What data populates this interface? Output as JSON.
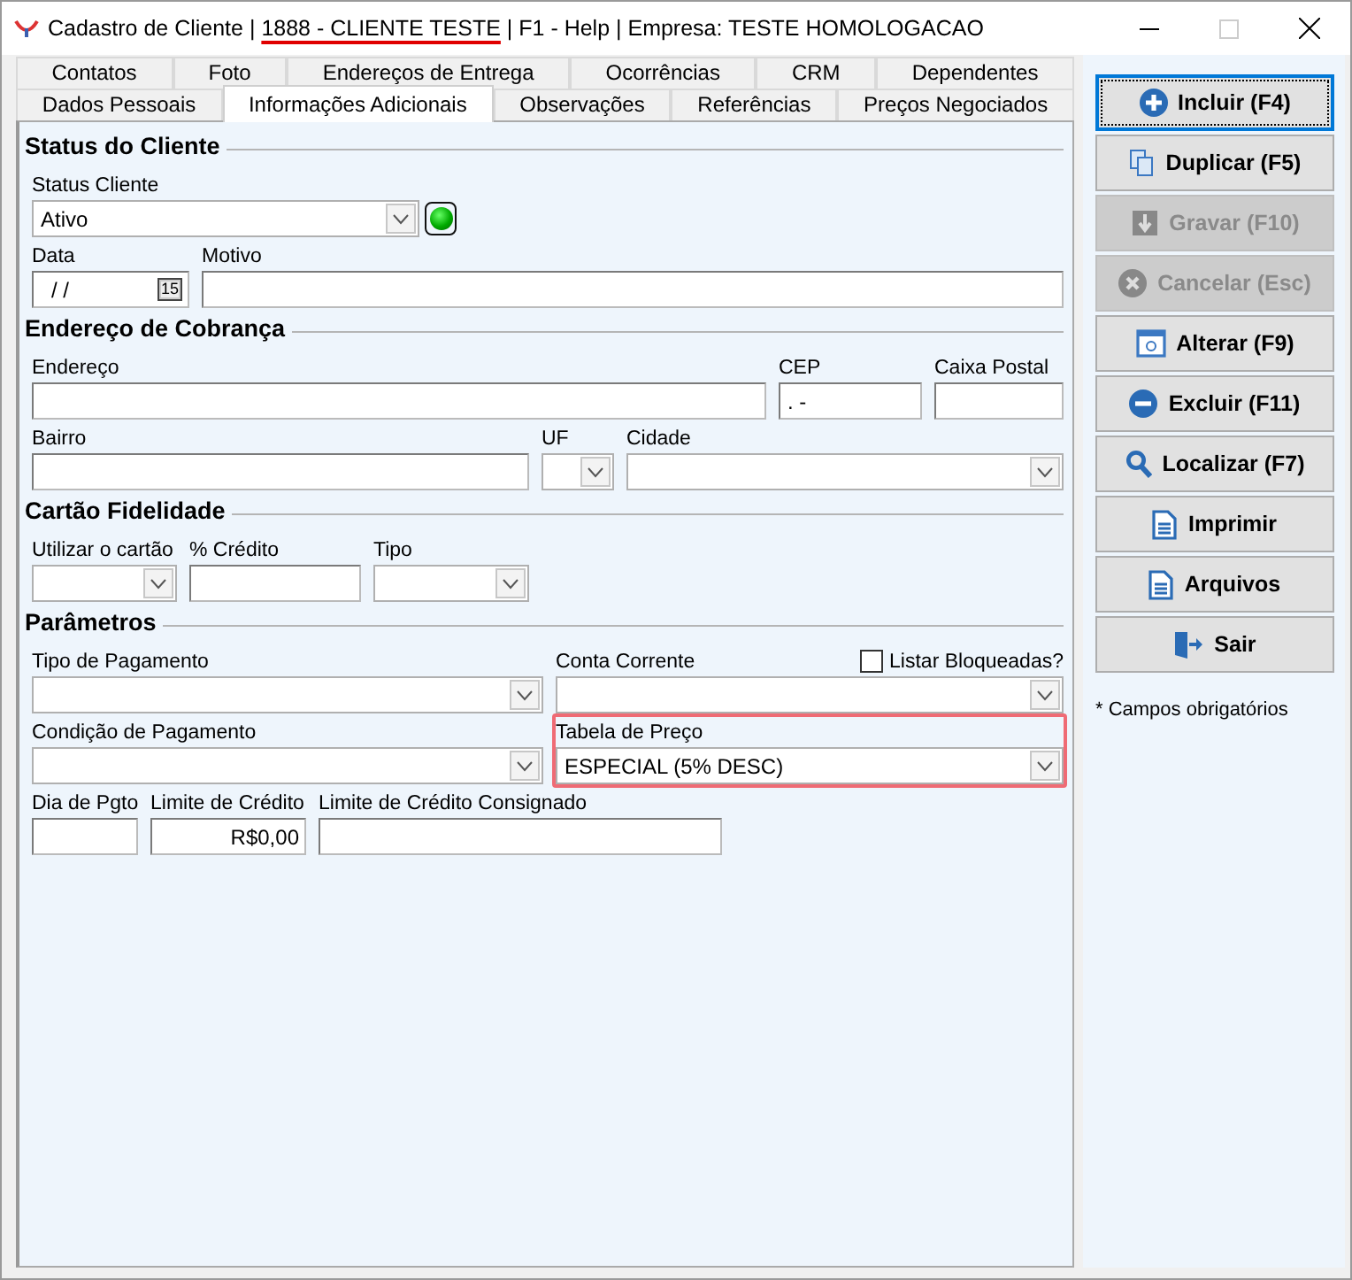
{
  "window": {
    "title_prefix": "Cadastro de Cliente |",
    "title_record": "1888 - CLIENTE TESTE",
    "title_suffix": "| F1 - Help | Empresa: TESTE HOMOLOGACAO",
    "maximize_disabled": true
  },
  "tab_rows": [
    [
      {
        "label": "Contatos",
        "selected": false
      },
      {
        "label": "Foto",
        "selected": false
      },
      {
        "label": "Endereços de Entrega",
        "selected": false
      },
      {
        "label": "Ocorrências",
        "selected": false
      },
      {
        "label": "CRM",
        "selected": false
      },
      {
        "label": "Dependentes",
        "selected": false
      }
    ],
    [
      {
        "label": "Dados Pessoais",
        "selected": false
      },
      {
        "label": "Informações Adicionais",
        "selected": true
      },
      {
        "label": "Observações",
        "selected": false
      },
      {
        "label": "Referências",
        "selected": false
      },
      {
        "label": "Preços Negociados",
        "selected": false
      }
    ]
  ],
  "sections": [
    {
      "title": "Status do Cliente",
      "rows": [
        [
          {
            "label": "Status Cliente",
            "kind": "select",
            "value": "Ativo",
            "indicator_on": true
          }
        ],
        [
          {
            "label": "Data",
            "kind": "date",
            "value": "/ /",
            "calendar_day": "15"
          },
          {
            "label": "Motivo",
            "kind": "input"
          }
        ]
      ]
    },
    {
      "title": "Endereço de Cobrança",
      "rows": [
        [
          {
            "label": "Endereço",
            "kind": "input"
          },
          {
            "label": "CEP",
            "kind": "input",
            "value": ". -"
          },
          {
            "label": "Caixa Postal",
            "kind": "input"
          }
        ],
        [
          {
            "label": "Bairro",
            "kind": "input"
          },
          {
            "label": "UF",
            "kind": "select"
          },
          {
            "label": "Cidade",
            "kind": "select"
          }
        ]
      ]
    },
    {
      "title": "Cartão Fidelidade",
      "rows": [
        [
          {
            "label": "Utilizar o cartão",
            "kind": "select"
          },
          {
            "label": "% Crédito",
            "kind": "input"
          },
          {
            "label": "Tipo",
            "kind": "select"
          }
        ]
      ]
    },
    {
      "title": "Parâmetros",
      "rows": [
        [
          {
            "label": "Tipo de Pagamento",
            "kind": "select"
          },
          {
            "label": "Conta Corrente",
            "kind": "select",
            "checkbox": {
              "label": "Listar Bloqueadas?",
              "checked": false
            }
          }
        ],
        [
          {
            "label": "Condição de Pagamento",
            "kind": "select"
          },
          {
            "label": "Tabela de Preço",
            "kind": "select",
            "value": "ESPECIAL (5% DESC)",
            "highlighted": true
          }
        ],
        [
          {
            "label": "Dia de Pgto",
            "kind": "input"
          },
          {
            "label": "Limite de Crédito",
            "kind": "currency",
            "value": "R$0,00"
          },
          {
            "label": "Limite de Crédito Consignado",
            "kind": "input"
          }
        ]
      ]
    }
  ],
  "buttons": [
    {
      "label": "Incluir (F4)",
      "kind": "plus",
      "disabled": false,
      "selected": true
    },
    {
      "label": "Duplicar (F5)",
      "kind": "copy",
      "disabled": false,
      "selected": false
    },
    {
      "label": "Gravar (F10)",
      "kind": "save",
      "disabled": true,
      "selected": false
    },
    {
      "label": "Cancelar (Esc)",
      "kind": "cancel",
      "disabled": true,
      "selected": false
    },
    {
      "label": "Alterar (F9)",
      "kind": "edit",
      "disabled": false,
      "selected": false
    },
    {
      "label": "Excluir (F11)",
      "kind": "minus",
      "disabled": false,
      "selected": false
    },
    {
      "label": "Localizar (F7)",
      "kind": "search",
      "disabled": false,
      "selected": false
    },
    {
      "label": "Imprimir",
      "kind": "document",
      "disabled": false,
      "selected": false
    },
    {
      "label": "Arquivos",
      "kind": "document",
      "disabled": false,
      "selected": false
    },
    {
      "label": "Sair",
      "kind": "exit",
      "disabled": false,
      "selected": false
    }
  ],
  "required_note": "* Campos obrigatórios"
}
